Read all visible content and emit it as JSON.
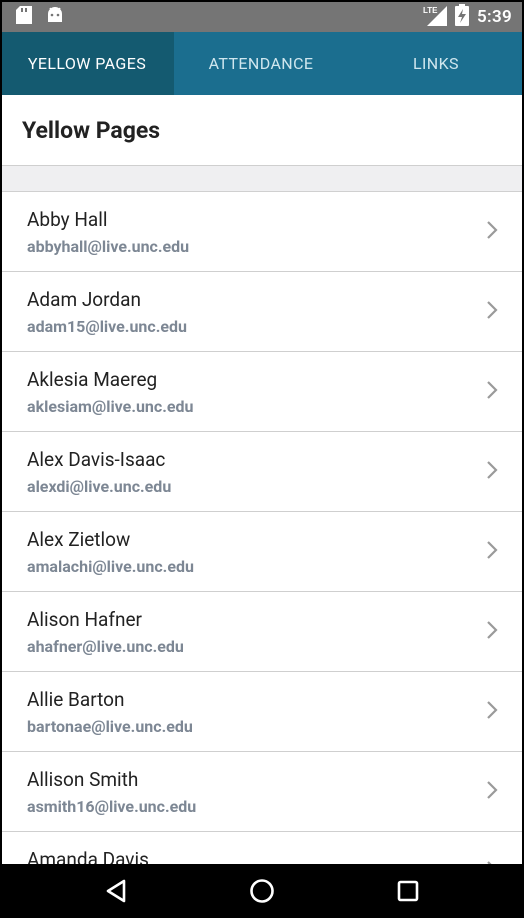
{
  "status_bar": {
    "time": "5:39",
    "left_icons": [
      "sd-card-icon",
      "android-icon"
    ],
    "right_icons": [
      "lte-signal-icon",
      "battery-charging-icon"
    ]
  },
  "tabs": [
    {
      "label": "YELLOW PAGES",
      "active": true
    },
    {
      "label": "ATTENDANCE",
      "active": false
    },
    {
      "label": "LINKS",
      "active": false
    }
  ],
  "header": {
    "title": "Yellow Pages"
  },
  "contacts": [
    {
      "name": "Abby Hall",
      "email": "abbyhall@live.unc.edu"
    },
    {
      "name": "Adam Jordan",
      "email": "adam15@live.unc.edu"
    },
    {
      "name": "Aklesia Maereg",
      "email": "aklesiam@live.unc.edu"
    },
    {
      "name": "Alex Davis-Isaac",
      "email": "alexdi@live.unc.edu"
    },
    {
      "name": "Alex Zietlow",
      "email": "amalachi@live.unc.edu"
    },
    {
      "name": "Alison Hafner",
      "email": "ahafner@live.unc.edu"
    },
    {
      "name": "Allie Barton",
      "email": "bartonae@live.unc.edu"
    },
    {
      "name": "Allison Smith",
      "email": "asmith16@live.unc.edu"
    },
    {
      "name": "Amanda Davis",
      "email": ""
    }
  ],
  "nav_bar": [
    "back-icon",
    "home-icon",
    "recents-icon"
  ],
  "colors": {
    "tab_bar": "#1b6e8f",
    "tab_active": "#145a70",
    "email_text": "#7d8794"
  }
}
